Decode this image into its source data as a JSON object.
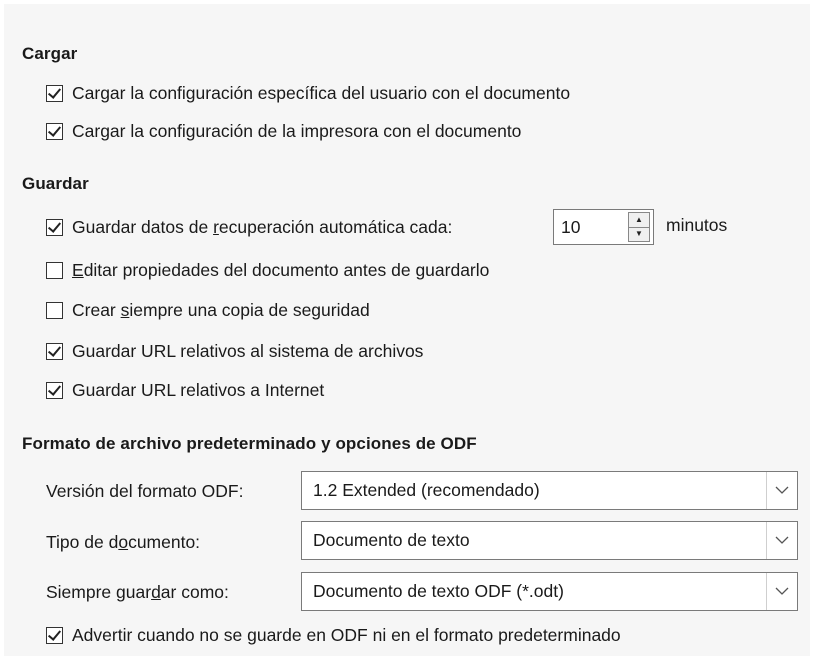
{
  "cargar": {
    "heading": "Cargar",
    "items": [
      {
        "label": "Cargar la configuración específica del usuario con el documento",
        "checked": true
      },
      {
        "label": "Cargar la configuración de la impresora con el documento",
        "checked": true
      }
    ]
  },
  "guardar": {
    "heading": "Guardar",
    "autosave": {
      "label_pre": "Guardar datos de ",
      "label_mn": "r",
      "label_post": "ecuperación automática cada:",
      "checked": true,
      "value": "10",
      "units": "minutos"
    },
    "items": [
      {
        "mn": "E",
        "rest": "ditar propiedades del documento antes de guardarlo",
        "checked": false
      },
      {
        "pre": "Crear ",
        "mn": "s",
        "rest": "iempre una copia de seguridad",
        "checked": false
      },
      {
        "label": "Guardar URL relativos al sistema de archivos",
        "checked": true
      },
      {
        "label": "Guardar URL relativos a Internet",
        "checked": true
      }
    ]
  },
  "formato": {
    "heading": "Formato de archivo predeterminado y opciones de ODF",
    "odf_version": {
      "label": "Versión del formato ODF:",
      "value": "1.2 Extended (recomendado)"
    },
    "doc_type": {
      "label_pre": "Tipo de d",
      "label_mn": "o",
      "label_post": "cumento:",
      "value": "Documento de texto"
    },
    "save_as": {
      "label_pre": "Siempre guar",
      "label_mn": "d",
      "label_post": "ar como:",
      "value": "Documento de texto ODF (*.odt)"
    },
    "warn": {
      "label": "Advertir cuando no se guarde en ODF ni en el formato predeterminado",
      "checked": true
    }
  }
}
